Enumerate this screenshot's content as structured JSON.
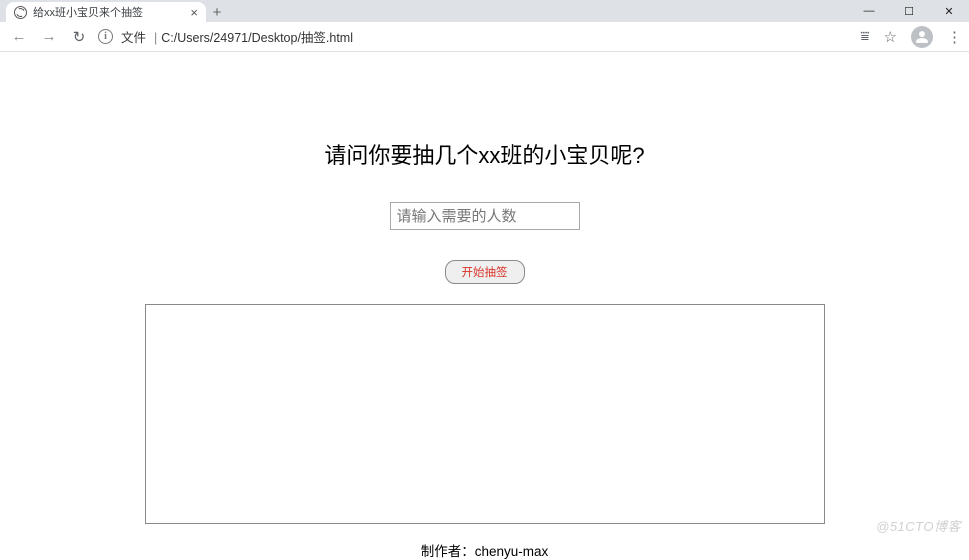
{
  "browser": {
    "tab_title": "给xx班小宝贝来个抽签",
    "url_label": "文件",
    "url_path": "C:/Users/24971/Desktop/抽签.html",
    "icons": {
      "back": "←",
      "forward": "→",
      "reload": "↻",
      "info": "i",
      "translate": "⩸",
      "star": "☆",
      "menu": "⋮",
      "close_tab": "×",
      "new_tab": "+",
      "minimize": "—",
      "maximize": "☐",
      "close_win": "✕"
    }
  },
  "page": {
    "heading": "请问你要抽几个xx班的小宝贝呢?",
    "input_placeholder": "请输入需要的人数",
    "start_button": "开始抽签",
    "footer": "制作者：chenyu-max"
  },
  "watermark": "@51CTO博客"
}
